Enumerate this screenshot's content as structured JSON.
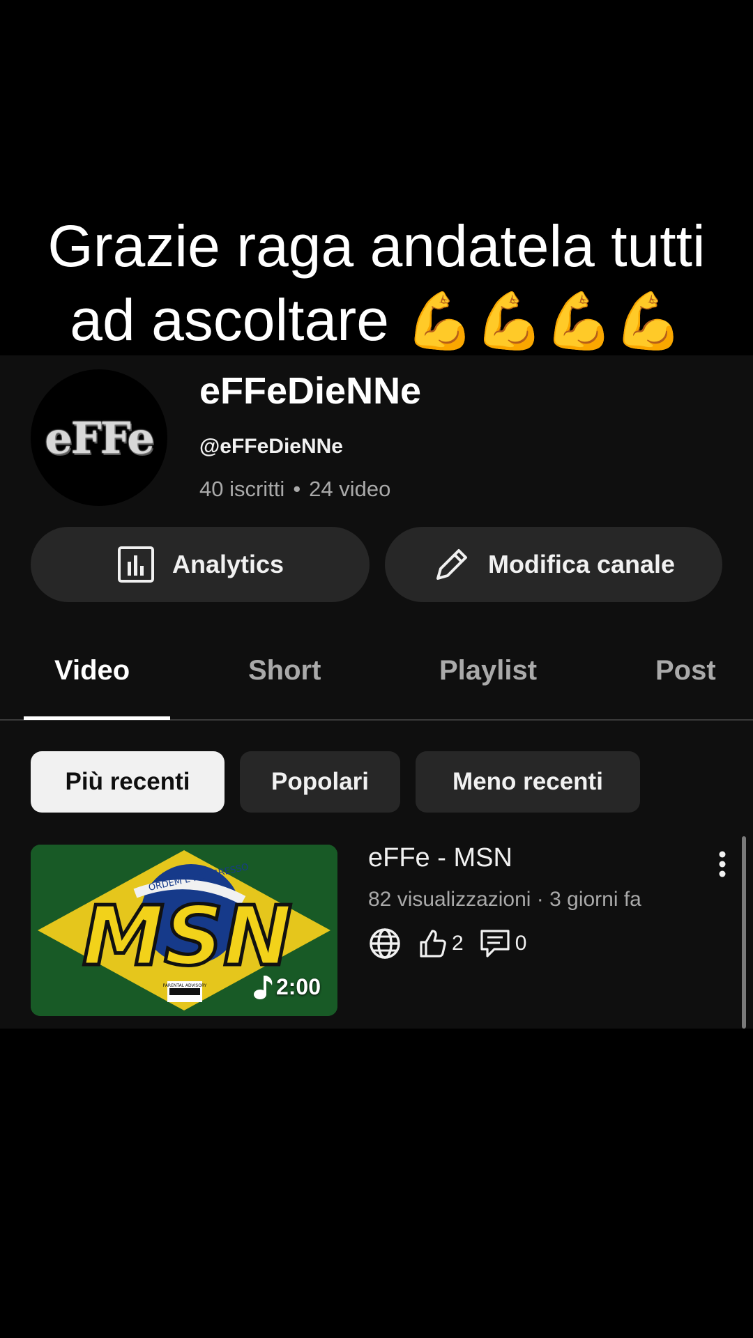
{
  "caption": {
    "line1": "Grazie raga andatela tutti",
    "line2": "ad ascoltare",
    "emoji": "💪💪💪💪"
  },
  "channel": {
    "avatar_text": "eFFe",
    "name": "eFFeDieNNe",
    "handle": "@eFFeDieNNe",
    "subscribers": "40 iscritti",
    "separator": "•",
    "videos": "24 video"
  },
  "actions": {
    "analytics_label": "Analytics",
    "analytics_icon": "bar-chart-icon",
    "edit_label": "Modifica canale",
    "edit_icon": "pencil-icon"
  },
  "tabs": [
    {
      "label": "Video",
      "active": true
    },
    {
      "label": "Short",
      "active": false
    },
    {
      "label": "Playlist",
      "active": false
    },
    {
      "label": "Post",
      "active": false
    }
  ],
  "filters": [
    {
      "label": "Più recenti",
      "selected": true
    },
    {
      "label": "Popolari",
      "selected": false
    },
    {
      "label": "Meno recenti",
      "selected": false
    }
  ],
  "video": {
    "title": "eFFe - MSN",
    "meta": "82 visualizzazioni · 3 giorni fa",
    "likes": "2",
    "comments": "0",
    "duration": "2:00",
    "thumbnail_text": "MSN",
    "thumbnail_banner": "ORDEM E PROGRESSO",
    "thumbnail_badge": "PARENTAL ADVISORY",
    "visibility_icon": "globe-icon"
  },
  "colors": {
    "background": "#0f0f0f",
    "chip": "#272727",
    "chip_selected": "#f1f1f1",
    "secondary_text": "#aaaaaa"
  }
}
